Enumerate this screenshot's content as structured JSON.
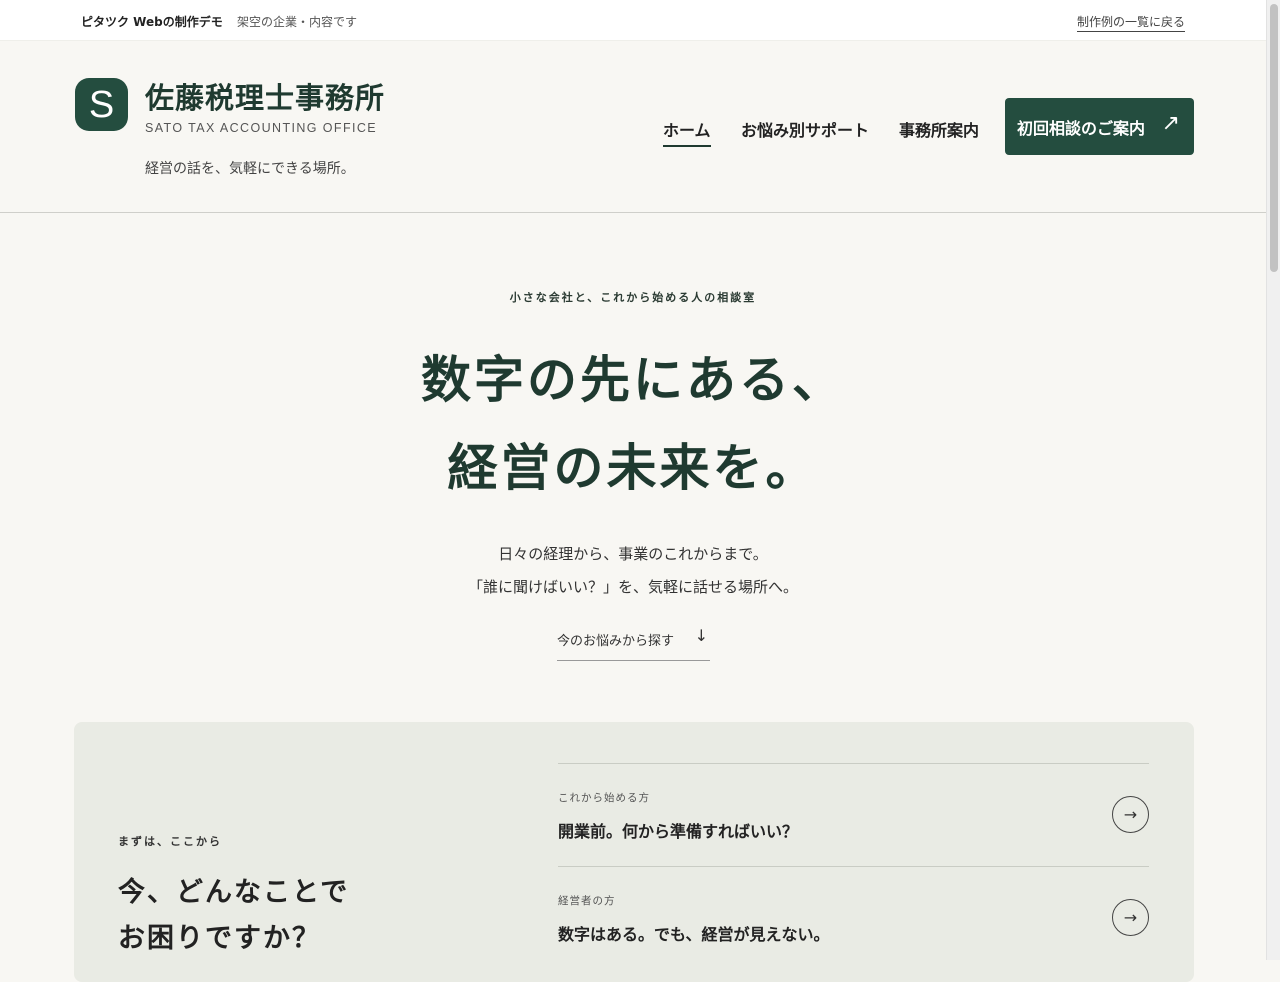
{
  "topbar": {
    "brand": "ピタツク Webの制作デモ",
    "note": "架空の企業・内容です",
    "back_link": "制作例の一覧に戻る"
  },
  "header": {
    "logo_letter": "S",
    "office_name": "佐藤税理士事務所",
    "office_name_en": "SATO TAX ACCOUNTING OFFICE",
    "tagline": "経営の話を、気軽にできる場所。",
    "nav": [
      {
        "label": "ホーム",
        "active": true
      },
      {
        "label": "お悩み別サポート",
        "active": false
      },
      {
        "label": "事務所案内",
        "active": false
      }
    ],
    "cta_label": "初回相談のご案内",
    "cta_icon": "arrow-up-right-icon"
  },
  "hero": {
    "eyebrow": "小さな会社と、これから始める人の相談室",
    "headline_line1": "数字の先にある、",
    "headline_line2": "経営の未来を。",
    "sub_line1": "日々の経理から、事業のこれからまで。",
    "sub_line2": "「誰に聞けばいい？」を、気軽に話せる場所へ。",
    "scroll_label": "今のお悩みから探す",
    "scroll_icon": "arrow-down-icon"
  },
  "panel": {
    "kicker": "まずは、ここから",
    "question_line1": "今、どんなことで",
    "question_line2": "お困りですか？",
    "items": [
      {
        "audience": "これから始める方",
        "title": "開業前。何から準備すればいい？"
      },
      {
        "audience": "経営者の方",
        "title": "数字はある。でも、経営が見えない。"
      }
    ]
  },
  "colors": {
    "brand": "#244d3f",
    "background": "#f8f7f3",
    "panel": "#e9ebe4"
  }
}
